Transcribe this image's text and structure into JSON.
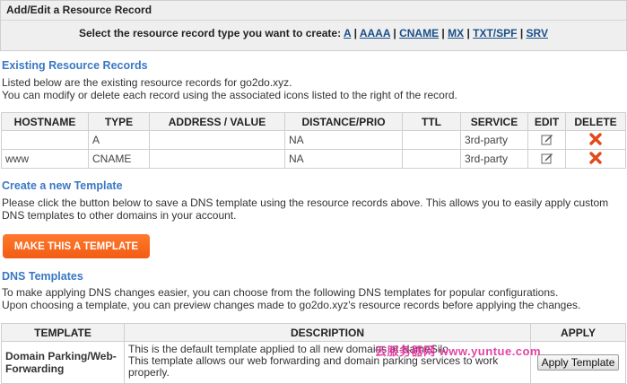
{
  "panel": {
    "title": "Add/Edit a Resource Record",
    "prompt": "Select the resource record type you want to create:",
    "types": [
      "A",
      "AAAA",
      "CNAME",
      "MX",
      "TXT/SPF",
      "SRV"
    ]
  },
  "existing": {
    "title": "Existing Resource Records",
    "line1": "Listed below are the existing resource records for go2do.xyz.",
    "line2": "You can modify or delete each record using the associated icons listed to the right of the record.",
    "headers": [
      "HOSTNAME",
      "TYPE",
      "ADDRESS / VALUE",
      "DISTANCE/PRIO",
      "TTL",
      "SERVICE",
      "EDIT",
      "DELETE"
    ],
    "rows": [
      {
        "hostname": "",
        "type": "A",
        "address": "",
        "distance": "NA",
        "ttl": "",
        "service": "3rd-party",
        "edit_icon": "edit-icon",
        "delete_icon": "delete-icon"
      },
      {
        "hostname": "www",
        "type": "CNAME",
        "address": "",
        "distance": "NA",
        "ttl": "",
        "service": "3rd-party",
        "edit_icon": "edit-icon",
        "delete_icon": "delete-icon"
      }
    ]
  },
  "create_template": {
    "title": "Create a new Template",
    "line1": "Please click the button below to save a DNS template using the resource records above. This allows you to easily apply custom",
    "line2": "DNS templates to other domains in your account.",
    "button": "MAKE THIS A TEMPLATE"
  },
  "dns_templates": {
    "title": "DNS Templates",
    "line1": "To make applying DNS changes easier, you can choose from the following DNS templates for popular configurations.",
    "line2": "Upon choosing a template, you can preview changes made to go2do.xyz's resource records before applying the changes.",
    "headers": [
      "TEMPLATE",
      "DESCRIPTION",
      "APPLY"
    ],
    "rows": [
      {
        "template_line1": "Domain Parking/Web-",
        "template_line2": "Forwarding",
        "desc_line1": "This is the default template applied to all new domains at NameSilo.",
        "desc_line2": "This template allows our web forwarding and domain parking services to work",
        "desc_line3": "properly.",
        "apply": "Apply Template"
      }
    ]
  },
  "watermark": "云服务器网 www.yuntue.com",
  "colors": {
    "accent_blue": "#3a78c3",
    "link": "#1a4f8a",
    "button_orange": "#f25c14",
    "delete_red": "#e2491c"
  }
}
